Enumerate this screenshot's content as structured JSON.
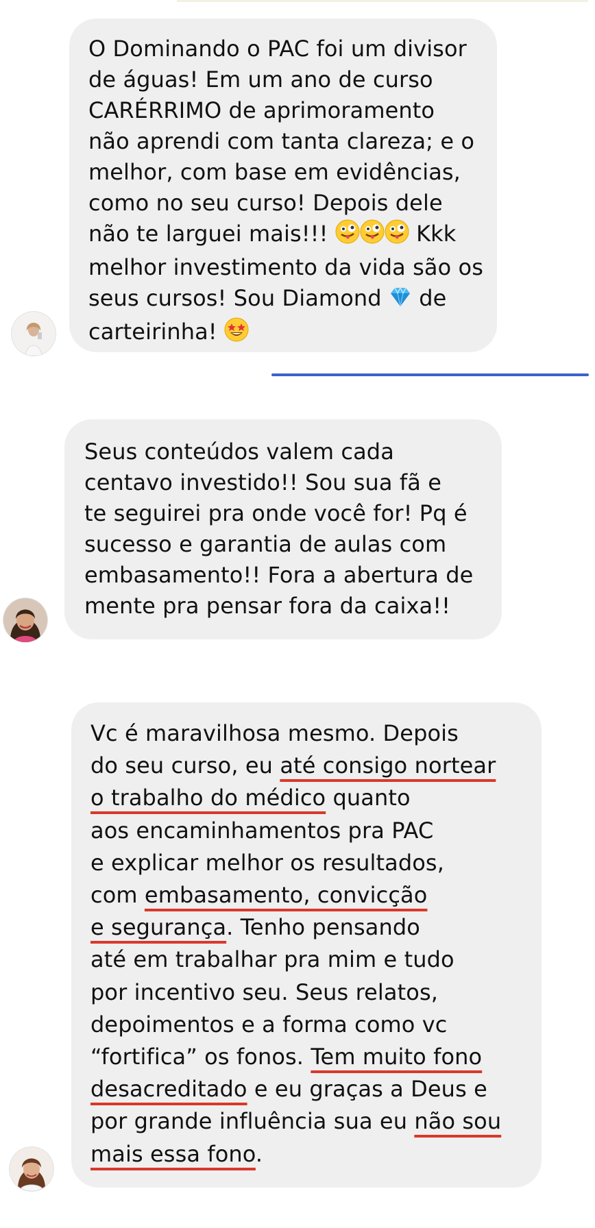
{
  "messages": [
    {
      "lines": [
        "O Dominando o PAC foi um divisor",
        "de águas! Em um ano de curso",
        "CARÉRRIMO de aprimoramento",
        "não aprendi com tanta clareza; e o",
        "melhor, com base em evidências,",
        "como no seu curso! Depois dele",
        "não te larguei mais!!!",
        "Kkk",
        "melhor investimento da vida são os",
        "seus cursos! Sou Diamond",
        "de",
        "carteirinha!"
      ]
    },
    {
      "lines": [
        "Seus conteúdos valem cada",
        "centavo investido!!  Sou sua fã e",
        "te seguirei pra onde você for! Pq é",
        "sucesso e garantia de aulas com",
        "embasamento!! Fora a abertura de",
        "mente pra pensar fora da caixa!!"
      ]
    },
    {
      "lines": [
        "Vc é maravilhosa mesmo. Depois",
        "do seu curso, eu ",
        "até consigo nortear",
        "o trabalho do médico",
        " quanto",
        "aos encaminhamentos pra PAC",
        "e explicar melhor os resultados,",
        "com ",
        "embasamento, convicção",
        "e segurança",
        ". Tenho pensando",
        "até em trabalhar pra mim e tudo",
        "por incentivo seu. Seus relatos,",
        "depoimentos e a forma como vc",
        "“fortifica” os fonos. ",
        "Tem muito fono",
        "desacreditado",
        " e eu graças a Deus e",
        "por grande influência sua eu ",
        "não sou",
        "mais essa fono",
        "."
      ]
    }
  ],
  "emoji": {
    "crazy_face": "crazy-face-emoji",
    "diamond": "gem-emoji",
    "star_struck": "star-struck-emoji"
  },
  "colors": {
    "bubble": "#efefef",
    "underline": "#d9382b",
    "divider": "#3b62cc"
  }
}
